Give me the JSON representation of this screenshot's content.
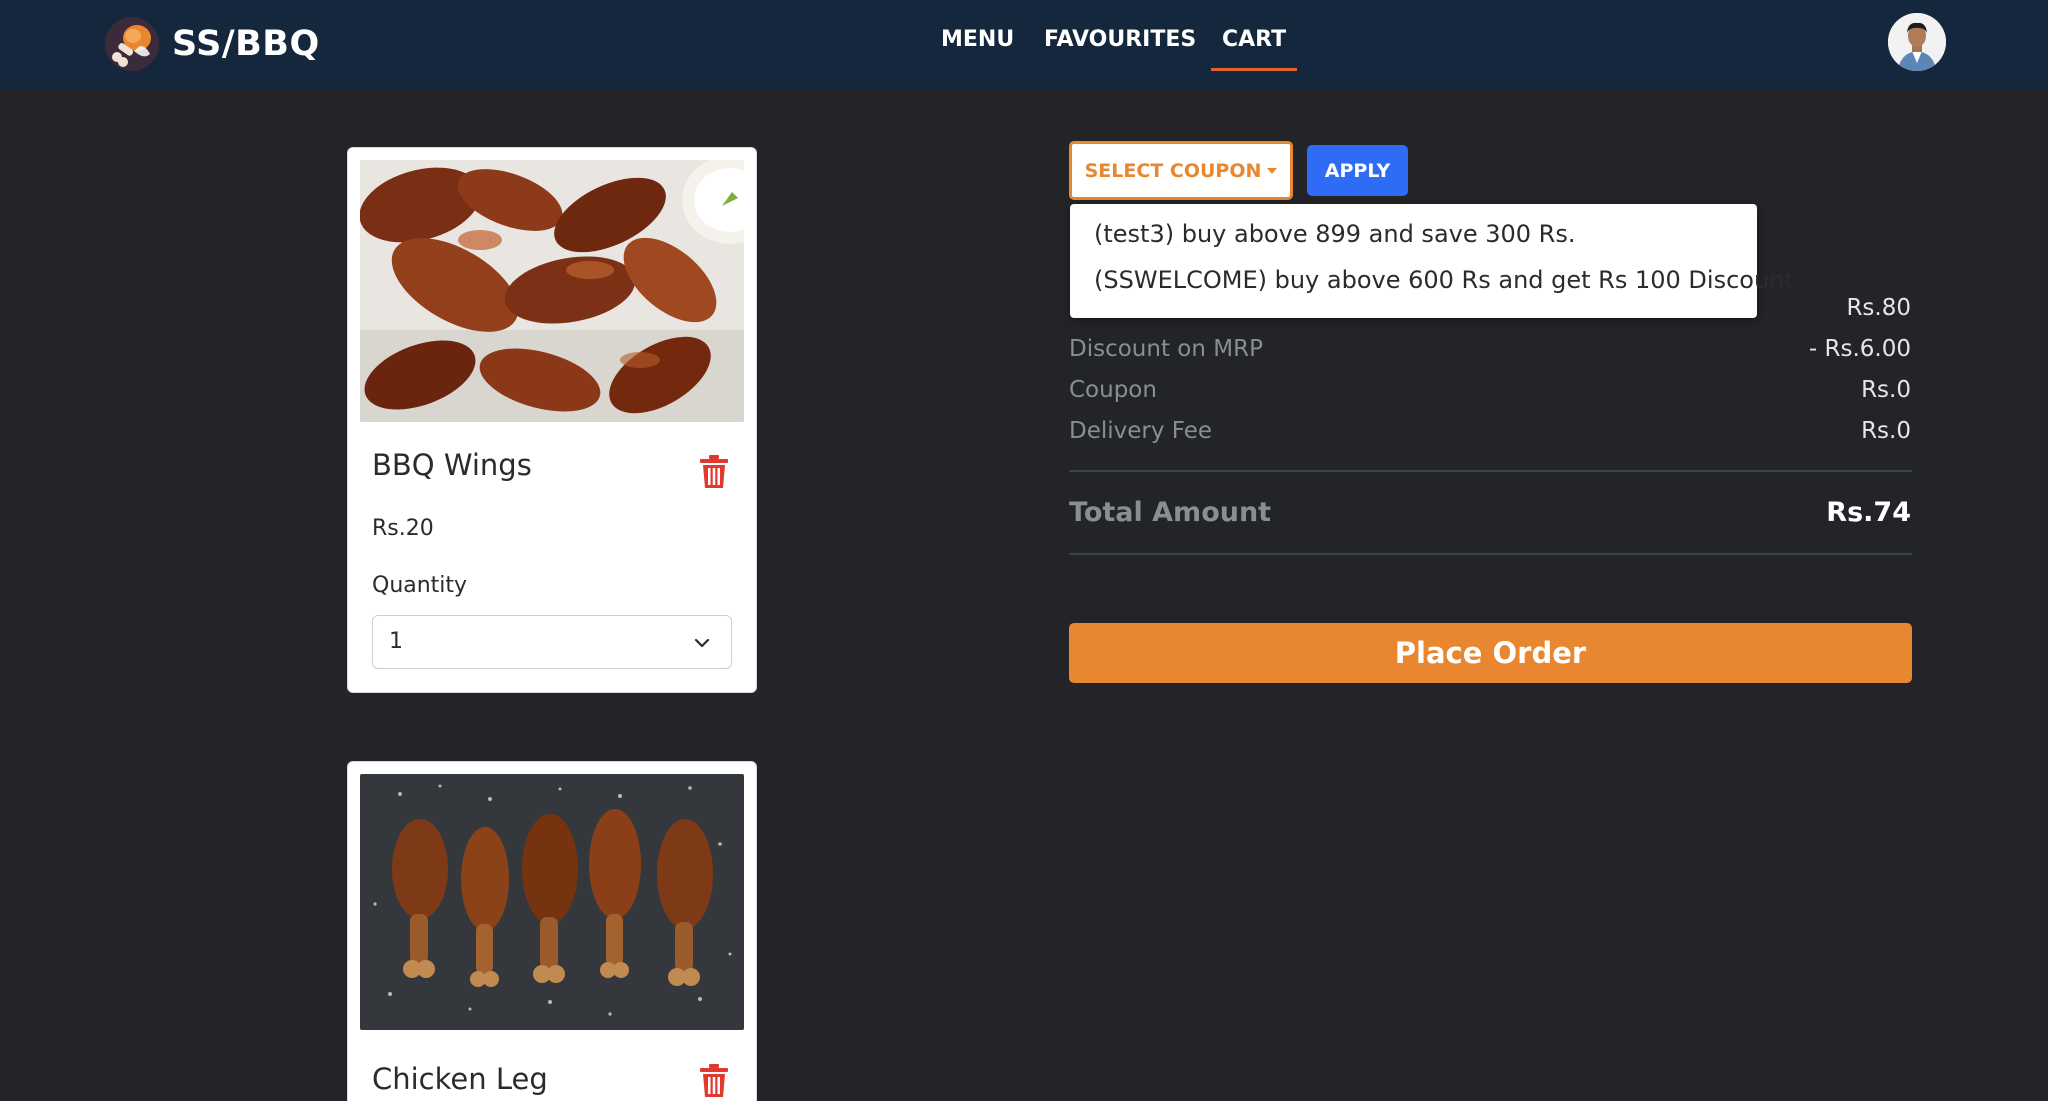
{
  "brand": {
    "name": "SS/BBQ",
    "logo_icon": "chicken-leg-logo-icon"
  },
  "nav": {
    "items": [
      {
        "label": "MENU"
      },
      {
        "label": "FAVOURITES"
      },
      {
        "label": "CART",
        "active": true
      }
    ],
    "active_color": "#e4602c"
  },
  "cart_items": [
    {
      "title": "BBQ Wings",
      "price": "Rs.20",
      "quantity_label": "Quantity",
      "quantity": "1"
    },
    {
      "title": "Chicken Leg"
    }
  ],
  "coupon": {
    "select_label": "SELECT COUPON",
    "apply_label": "APPLY",
    "options": [
      "(test3) buy above 899 and save 300 Rs.",
      "(SSWELCOME) buy above 600 Rs and get Rs 100 Discount"
    ]
  },
  "summary": {
    "mrp_value": "Rs.80",
    "rows": [
      {
        "label": "Discount on MRP",
        "value": "- Rs.6.00"
      },
      {
        "label": "Coupon",
        "value": "Rs.0"
      },
      {
        "label": "Delivery Fee",
        "value": "Rs.0"
      }
    ],
    "total_label": "Total Amount",
    "total_value": "Rs.74"
  },
  "place_order_label": "Place Order",
  "colors": {
    "accent": "#e8872f",
    "apply": "#2f6cf5",
    "navbar": "#14273c",
    "background": "#222428",
    "trash": "#e03a2f"
  }
}
